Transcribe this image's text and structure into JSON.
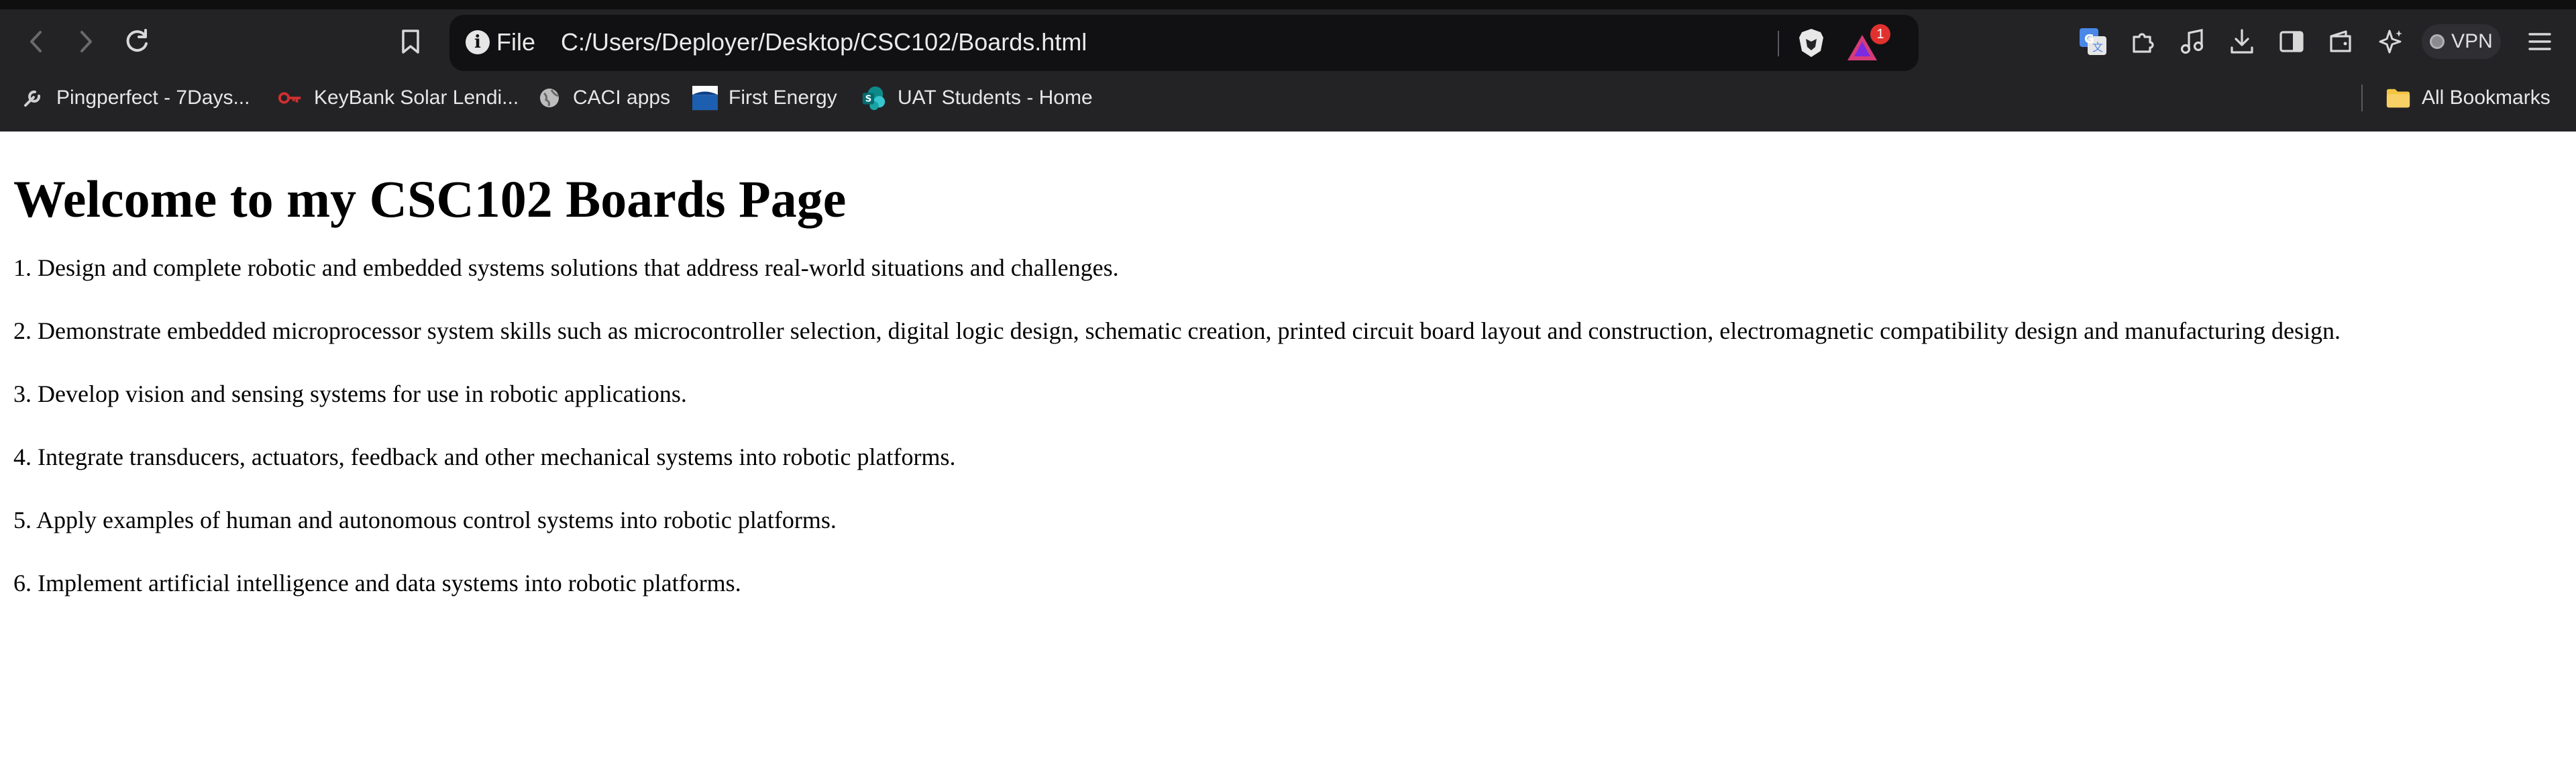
{
  "browser": {
    "address": {
      "scheme_label": "File",
      "url": "C:/Users/Deployer/Desktop/CSC102/Boards.html"
    },
    "rewards_badge_count": "1",
    "vpn_label": "VPN",
    "bookmarks": [
      {
        "label": "Pingperfect - 7Days...",
        "icon": "wrench-icon"
      },
      {
        "label": "KeyBank Solar Lendi...",
        "icon": "keybank-key-icon"
      },
      {
        "label": "CACI apps",
        "icon": "globe-icon"
      },
      {
        "label": "First Energy",
        "icon": "first-energy-logo-icon"
      },
      {
        "label": "UAT Students - Home",
        "icon": "sharepoint-icon"
      }
    ],
    "all_bookmarks_label": "All Bookmarks",
    "colors": {
      "chrome_bg": "#232326",
      "address_bg": "#111113",
      "badge": "#e0312f",
      "folder": "#f4c542"
    }
  },
  "page": {
    "heading": "Welcome to my CSC102 Boards Page",
    "paragraphs": [
      "1. Design and complete robotic and embedded systems solutions that address real-world situations and challenges.",
      "2. Demonstrate embedded microprocessor system skills such as microcontroller selection, digital logic design, schematic creation, printed circuit board layout and construction, electromagnetic compatibility design and manufacturing design.",
      "3. Develop vision and sensing systems for use in robotic applications.",
      "4. Integrate transducers, actuators, feedback and other mechanical systems into robotic platforms.",
      "5. Apply examples of human and autonomous control systems into robotic platforms.",
      "6. Implement artificial intelligence and data systems into robotic platforms."
    ]
  }
}
